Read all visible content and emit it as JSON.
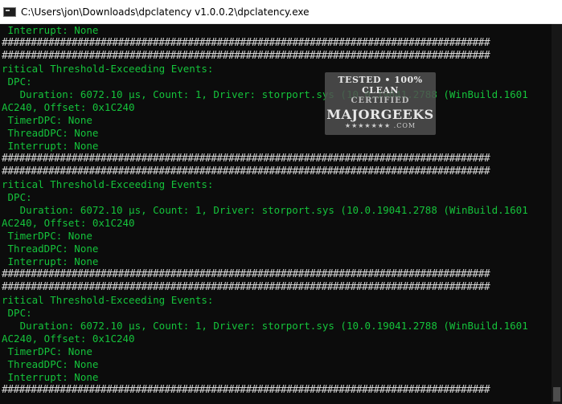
{
  "window": {
    "title": "C:\\Users\\jon\\Downloads\\dpclatency v1.0.0.2\\dpclatency.exe"
  },
  "console": {
    "lines": [
      " Interrupt: None",
      "####################################################################################",
      "####################################################################################",
      "ritical Threshold-Exceeding Events:",
      " DPC:",
      "   Duration: 6072.10 µs, Count: 1, Driver: storport.sys (10.0.19041.2788 (WinBuild.1601",
      "AC240, Offset: 0x1C240",
      " TimerDPC: None",
      " ThreadDPC: None",
      " Interrupt: None",
      "####################################################################################",
      "####################################################################################",
      "ritical Threshold-Exceeding Events:",
      " DPC:",
      "   Duration: 6072.10 µs, Count: 1, Driver: storport.sys (10.0.19041.2788 (WinBuild.1601",
      "AC240, Offset: 0x1C240",
      " TimerDPC: None",
      " ThreadDPC: None",
      " Interrupt: None",
      "####################################################################################",
      "####################################################################################",
      "ritical Threshold-Exceeding Events:",
      " DPC:",
      "   Duration: 6072.10 µs, Count: 1, Driver: storport.sys (10.0.19041.2788 (WinBuild.1601",
      "AC240, Offset: 0x1C240",
      " TimerDPC: None",
      " ThreadDPC: None",
      " Interrupt: None",
      "####################################################################################"
    ]
  },
  "watermark": {
    "line1": "TESTED • 100% CLEAN",
    "stamp": "CERTIFIED",
    "brand": "MAJORGEEKS",
    "sub": "★★★★★★★ .COM"
  },
  "colors": {
    "background": "#0c0c0c",
    "text_green": "#15c33b",
    "hash_gray": "#d6d6d6"
  }
}
